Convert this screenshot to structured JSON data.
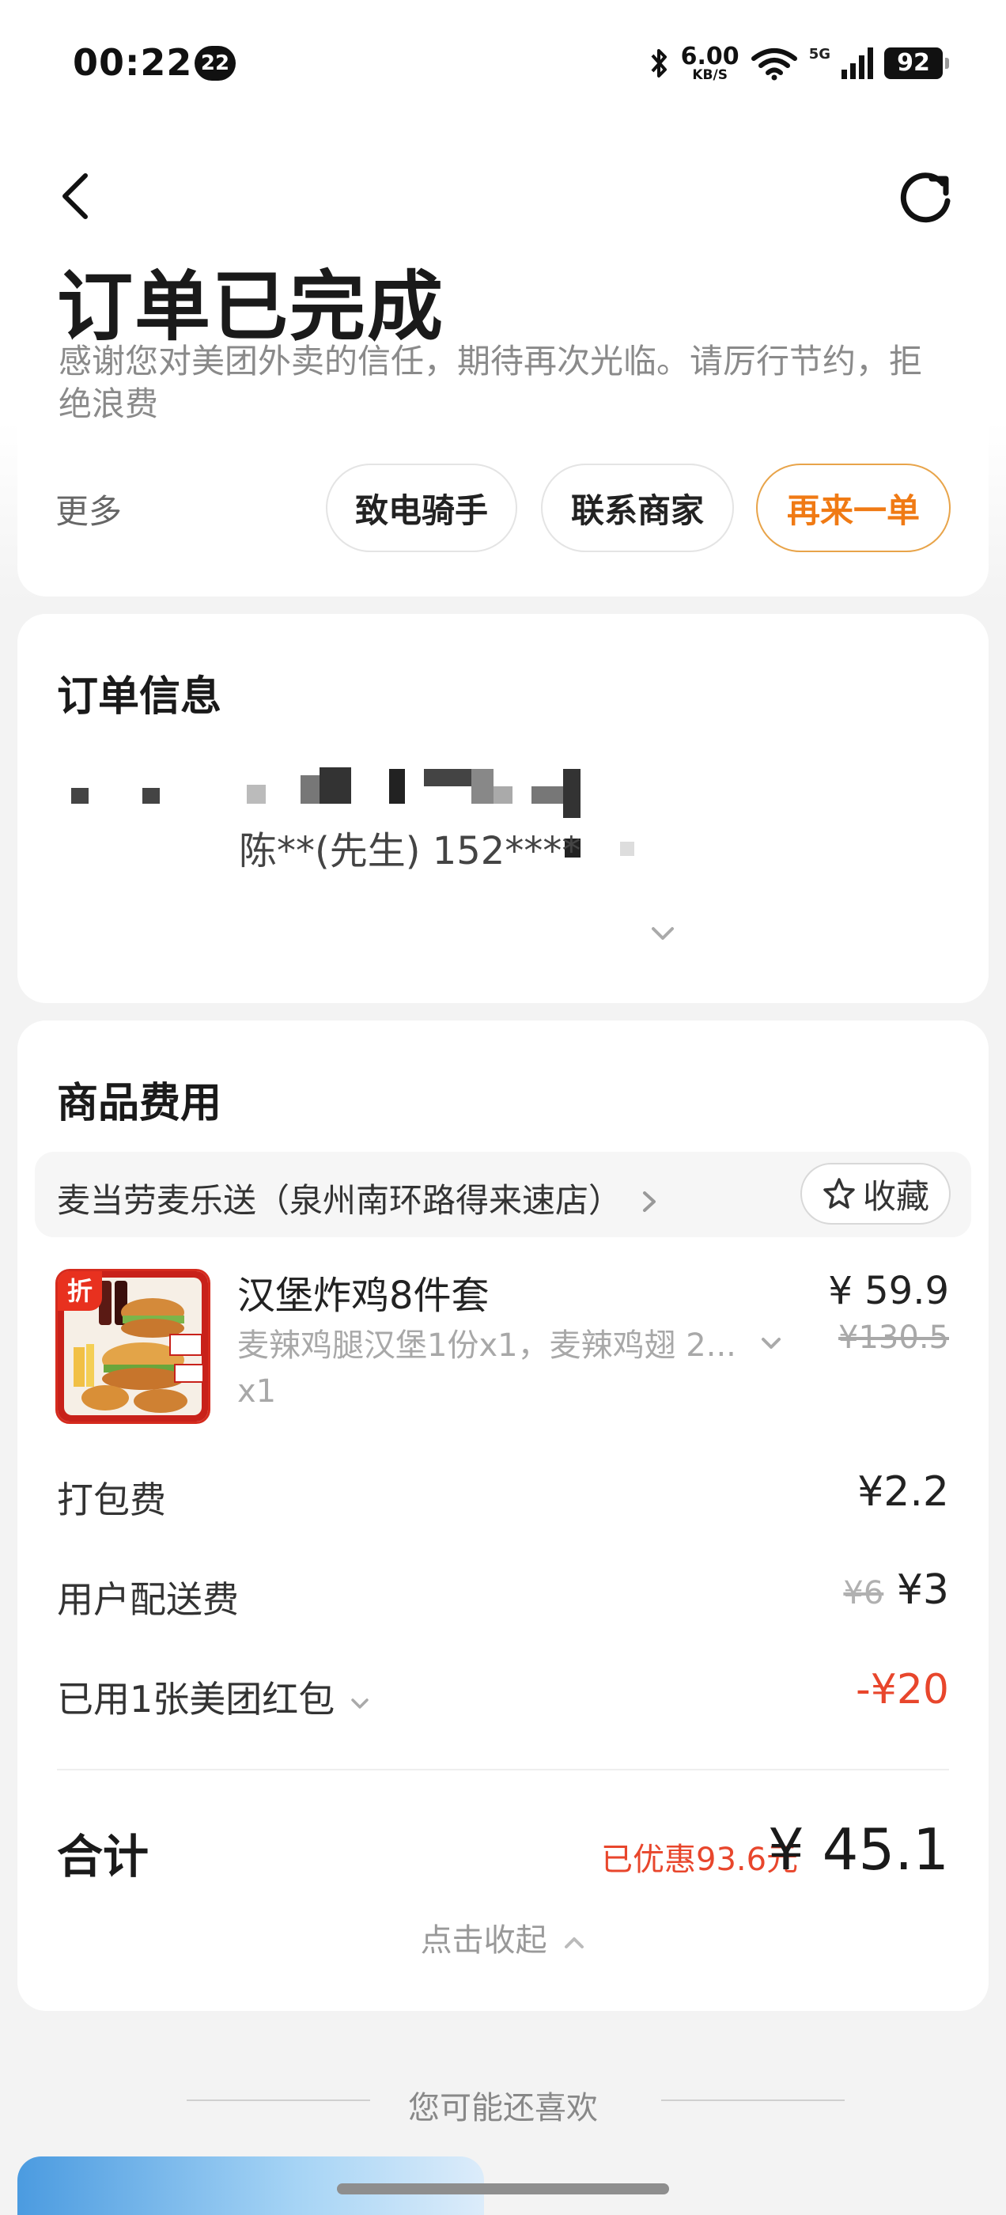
{
  "status_bar": {
    "time": "00:22",
    "notification_count": "22",
    "net_speed": "6.00",
    "net_speed_unit": "KB/S",
    "network": "5G",
    "battery": "92"
  },
  "header": {
    "title": "订单已完成",
    "subtitle": "感谢您对美团外卖的信任，期待再次光临。请厉行节约，拒绝浪费",
    "more_label": "更多",
    "buttons": {
      "call_rider": "致电骑手",
      "contact_store": "联系商家",
      "reorder": "再来一单"
    }
  },
  "order_info": {
    "title": "订单信息",
    "contact": "陈**(先生) 152****"
  },
  "goods": {
    "title": "商品费用",
    "store_name": "麦当劳麦乐送（泉州南环路得来速店）",
    "favorite_label": "收藏",
    "thumb_badge": "折",
    "item": {
      "name": "汉堡炸鸡8件套",
      "desc": "麦辣鸡腿汉堡1份x1，麦辣鸡翅 2...",
      "qty": "x1",
      "price": "¥ 59.9",
      "original_price": "¥130.5"
    },
    "packing_fee": {
      "label": "打包费",
      "value": "¥2.2"
    },
    "delivery_fee": {
      "label": "用户配送费",
      "original": "¥6",
      "value": "¥3"
    },
    "coupon": {
      "label": "已用1张美团红包",
      "value": "-¥20"
    },
    "total": {
      "label": "合计",
      "saved": "已优惠93.6元",
      "value": "¥ 45.1"
    },
    "collapse_label": "点击收起"
  },
  "recommend": {
    "title": "您可能还喜欢"
  },
  "colors": {
    "accent_orange": "#f07a14",
    "discount_red": "#e8462c",
    "background": "#f3f3f3"
  }
}
